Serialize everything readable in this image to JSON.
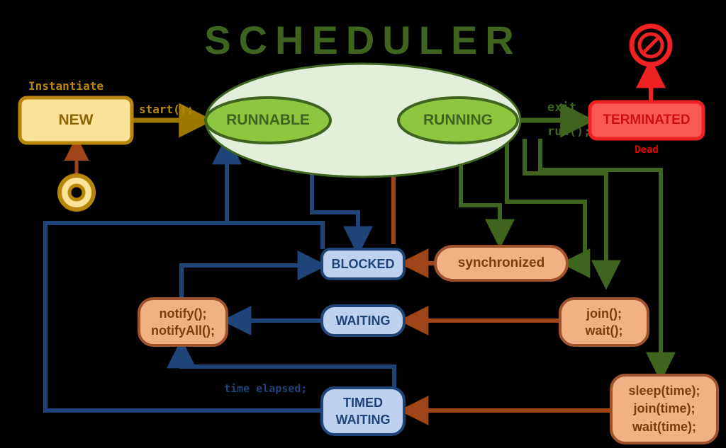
{
  "title": "SCHEDULER",
  "colors": {
    "bg": "#000000",
    "title_green": "#3f6420",
    "scheduler_ellipse_fill": "#e3eedb",
    "scheduler_ellipse_stroke": "#3f6420",
    "state_green_fill": "#8dc63f",
    "state_green_stroke": "#3f6420",
    "state_green_text": "#3f6420",
    "new_fill": "#fce39a",
    "new_stroke": "#b8860b",
    "new_text": "#8b6508",
    "gold_arrow": "#9c7a00",
    "gold_label": "#b8860b",
    "terminated_fill": "#fb5a52",
    "terminated_stroke": "#ee2222",
    "terminated_text": "#cc1111",
    "dead_text": "#e00000",
    "blue_fill": "#bcd2ef",
    "blue_stroke": "#1f4478",
    "blue_text": "#1f4478",
    "peach_fill": "#f2b184",
    "peach_stroke": "#a0522d",
    "peach_text": "#7d3c10",
    "brown_arrow": "#a0441a",
    "green_arrow": "#3f6420",
    "navy_arrow": "#1f4478"
  },
  "nodes": {
    "new": {
      "label": "NEW",
      "caption": "Instantiate"
    },
    "runnable": {
      "label": "RUNNABLE"
    },
    "running": {
      "label": "RUNNING"
    },
    "terminated": {
      "label": "TERMINATED",
      "caption": "Dead"
    },
    "blocked": {
      "label": "BLOCKED"
    },
    "waiting": {
      "label": "WAITING"
    },
    "timed_waiting": {
      "line1": "TIMED",
      "line2": "WAITING"
    },
    "synchronized": {
      "label": "synchronized"
    },
    "notify": {
      "line1": "notify();",
      "line2": "notifyAll();"
    },
    "join_wait": {
      "line1": "join();",
      "line2": "wait();"
    },
    "sleep_time": {
      "line1": "sleep(time);",
      "line2": "join(time);",
      "line3": "wait(time);"
    },
    "start_marker": {
      "label": "start-state-marker"
    },
    "stop_marker": {
      "label": "no-entry-sign"
    }
  },
  "edge_labels": {
    "start": "start();",
    "exit": "exit",
    "run": "run();",
    "time_elapsed": "time elapsed;"
  }
}
